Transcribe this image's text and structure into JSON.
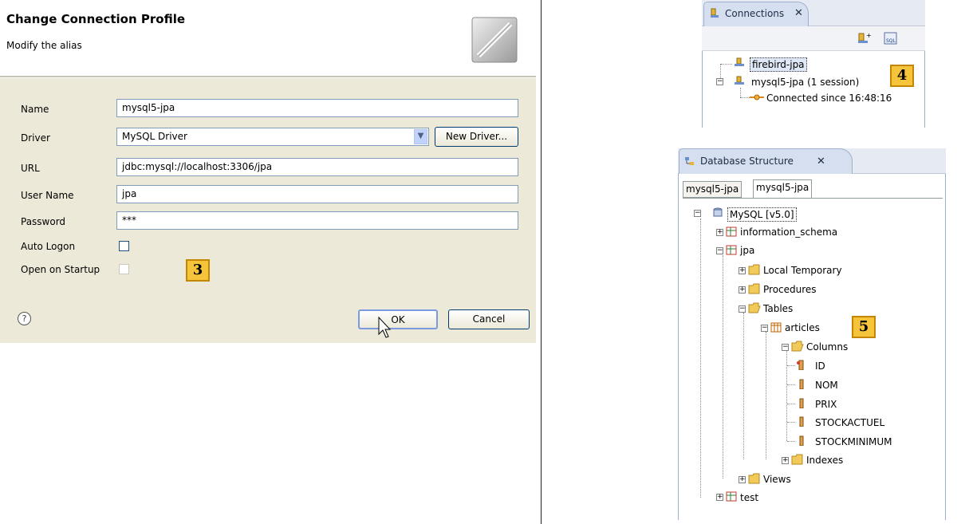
{
  "dialog": {
    "title": "Change Connection Profile",
    "subtitle": "Modify the alias",
    "fields": {
      "name_label": "Name",
      "name_value": "mysql5-jpa",
      "driver_label": "Driver",
      "driver_value": "MySQL Driver",
      "new_driver_button": "New Driver...",
      "url_label": "URL",
      "url_value": "jdbc:mysql://localhost:3306/jpa",
      "username_label": "User Name",
      "username_value": "jpa",
      "password_label": "Password",
      "password_value": "***",
      "auto_logon_label": "Auto Logon",
      "open_on_startup_label": "Open on Startup"
    },
    "ok_button": "OK",
    "cancel_button": "Cancel",
    "help_glyph": "?",
    "badge": "3"
  },
  "connections": {
    "tab_title": "Connections",
    "close_glyph": "✕",
    "items": [
      {
        "label": "firebird-jpa"
      },
      {
        "label": "mysql5-jpa (1 session)"
      },
      {
        "label": "Connected since 16:48:16"
      }
    ],
    "badge": "4"
  },
  "database_structure": {
    "tab_title": "Database Structure",
    "close_glyph": "✕",
    "subtabs": [
      "mysql5-jpa",
      "mysql5-jpa"
    ],
    "tree": {
      "root": "MySQL  [v5.0]",
      "schemas": [
        "information_schema",
        "jpa",
        "test"
      ],
      "jpa_children": [
        "Local Temporary",
        "Procedures",
        "Tables",
        "Views"
      ],
      "table": "articles",
      "columns_folder": "Columns",
      "columns": [
        "ID",
        "NOM",
        "PRIX",
        "STOCKACTUEL",
        "STOCKMINIMUM"
      ],
      "indexes": "Indexes"
    },
    "badge": "5"
  },
  "colors": {
    "dialog_bg": "#ece9d8",
    "badge_bg": "#f6c43a",
    "selection_border": "#316ac5",
    "folder": "#f2c95b"
  }
}
